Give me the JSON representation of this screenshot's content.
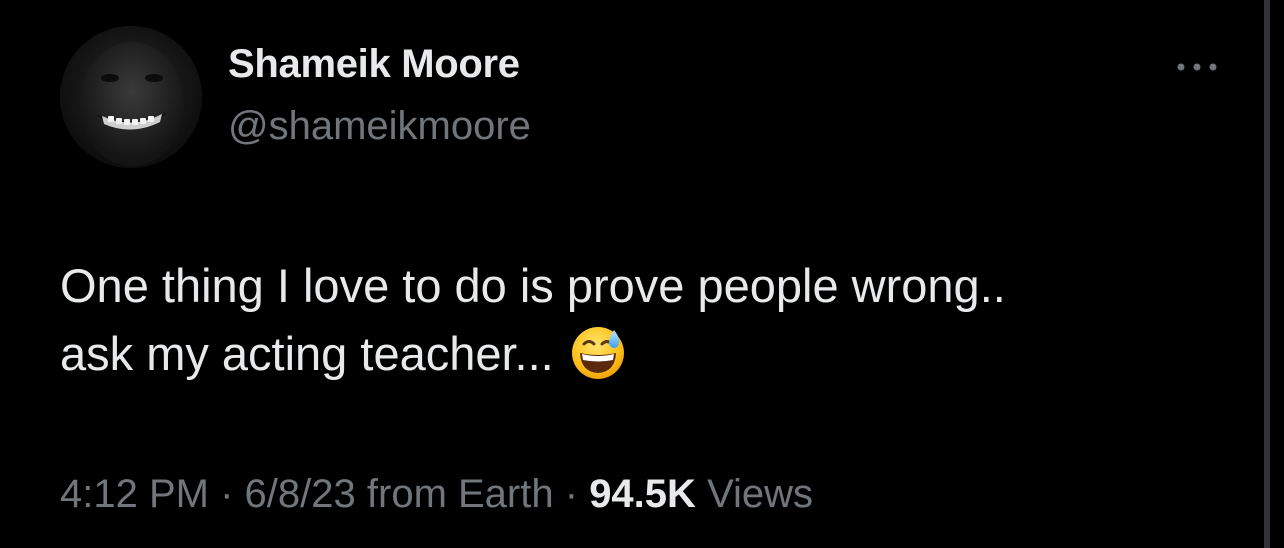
{
  "author": {
    "display_name": "Shameik Moore",
    "handle": "@shameikmoore"
  },
  "tweet": {
    "line1": "One thing I love to do is prove people wrong..",
    "line2": "ask my acting teacher...",
    "emoji": "grinning-face-with-sweat-icon"
  },
  "meta": {
    "time": "4:12 PM",
    "separator": "·",
    "date": "6/8/23",
    "source": "from Earth",
    "views_count": "94.5K",
    "views_label": "Views"
  },
  "icons": {
    "more": "more-horizontal-icon"
  },
  "colors": {
    "background": "#000000",
    "primary_text": "#e7e9ea",
    "secondary_text": "#71767b"
  }
}
